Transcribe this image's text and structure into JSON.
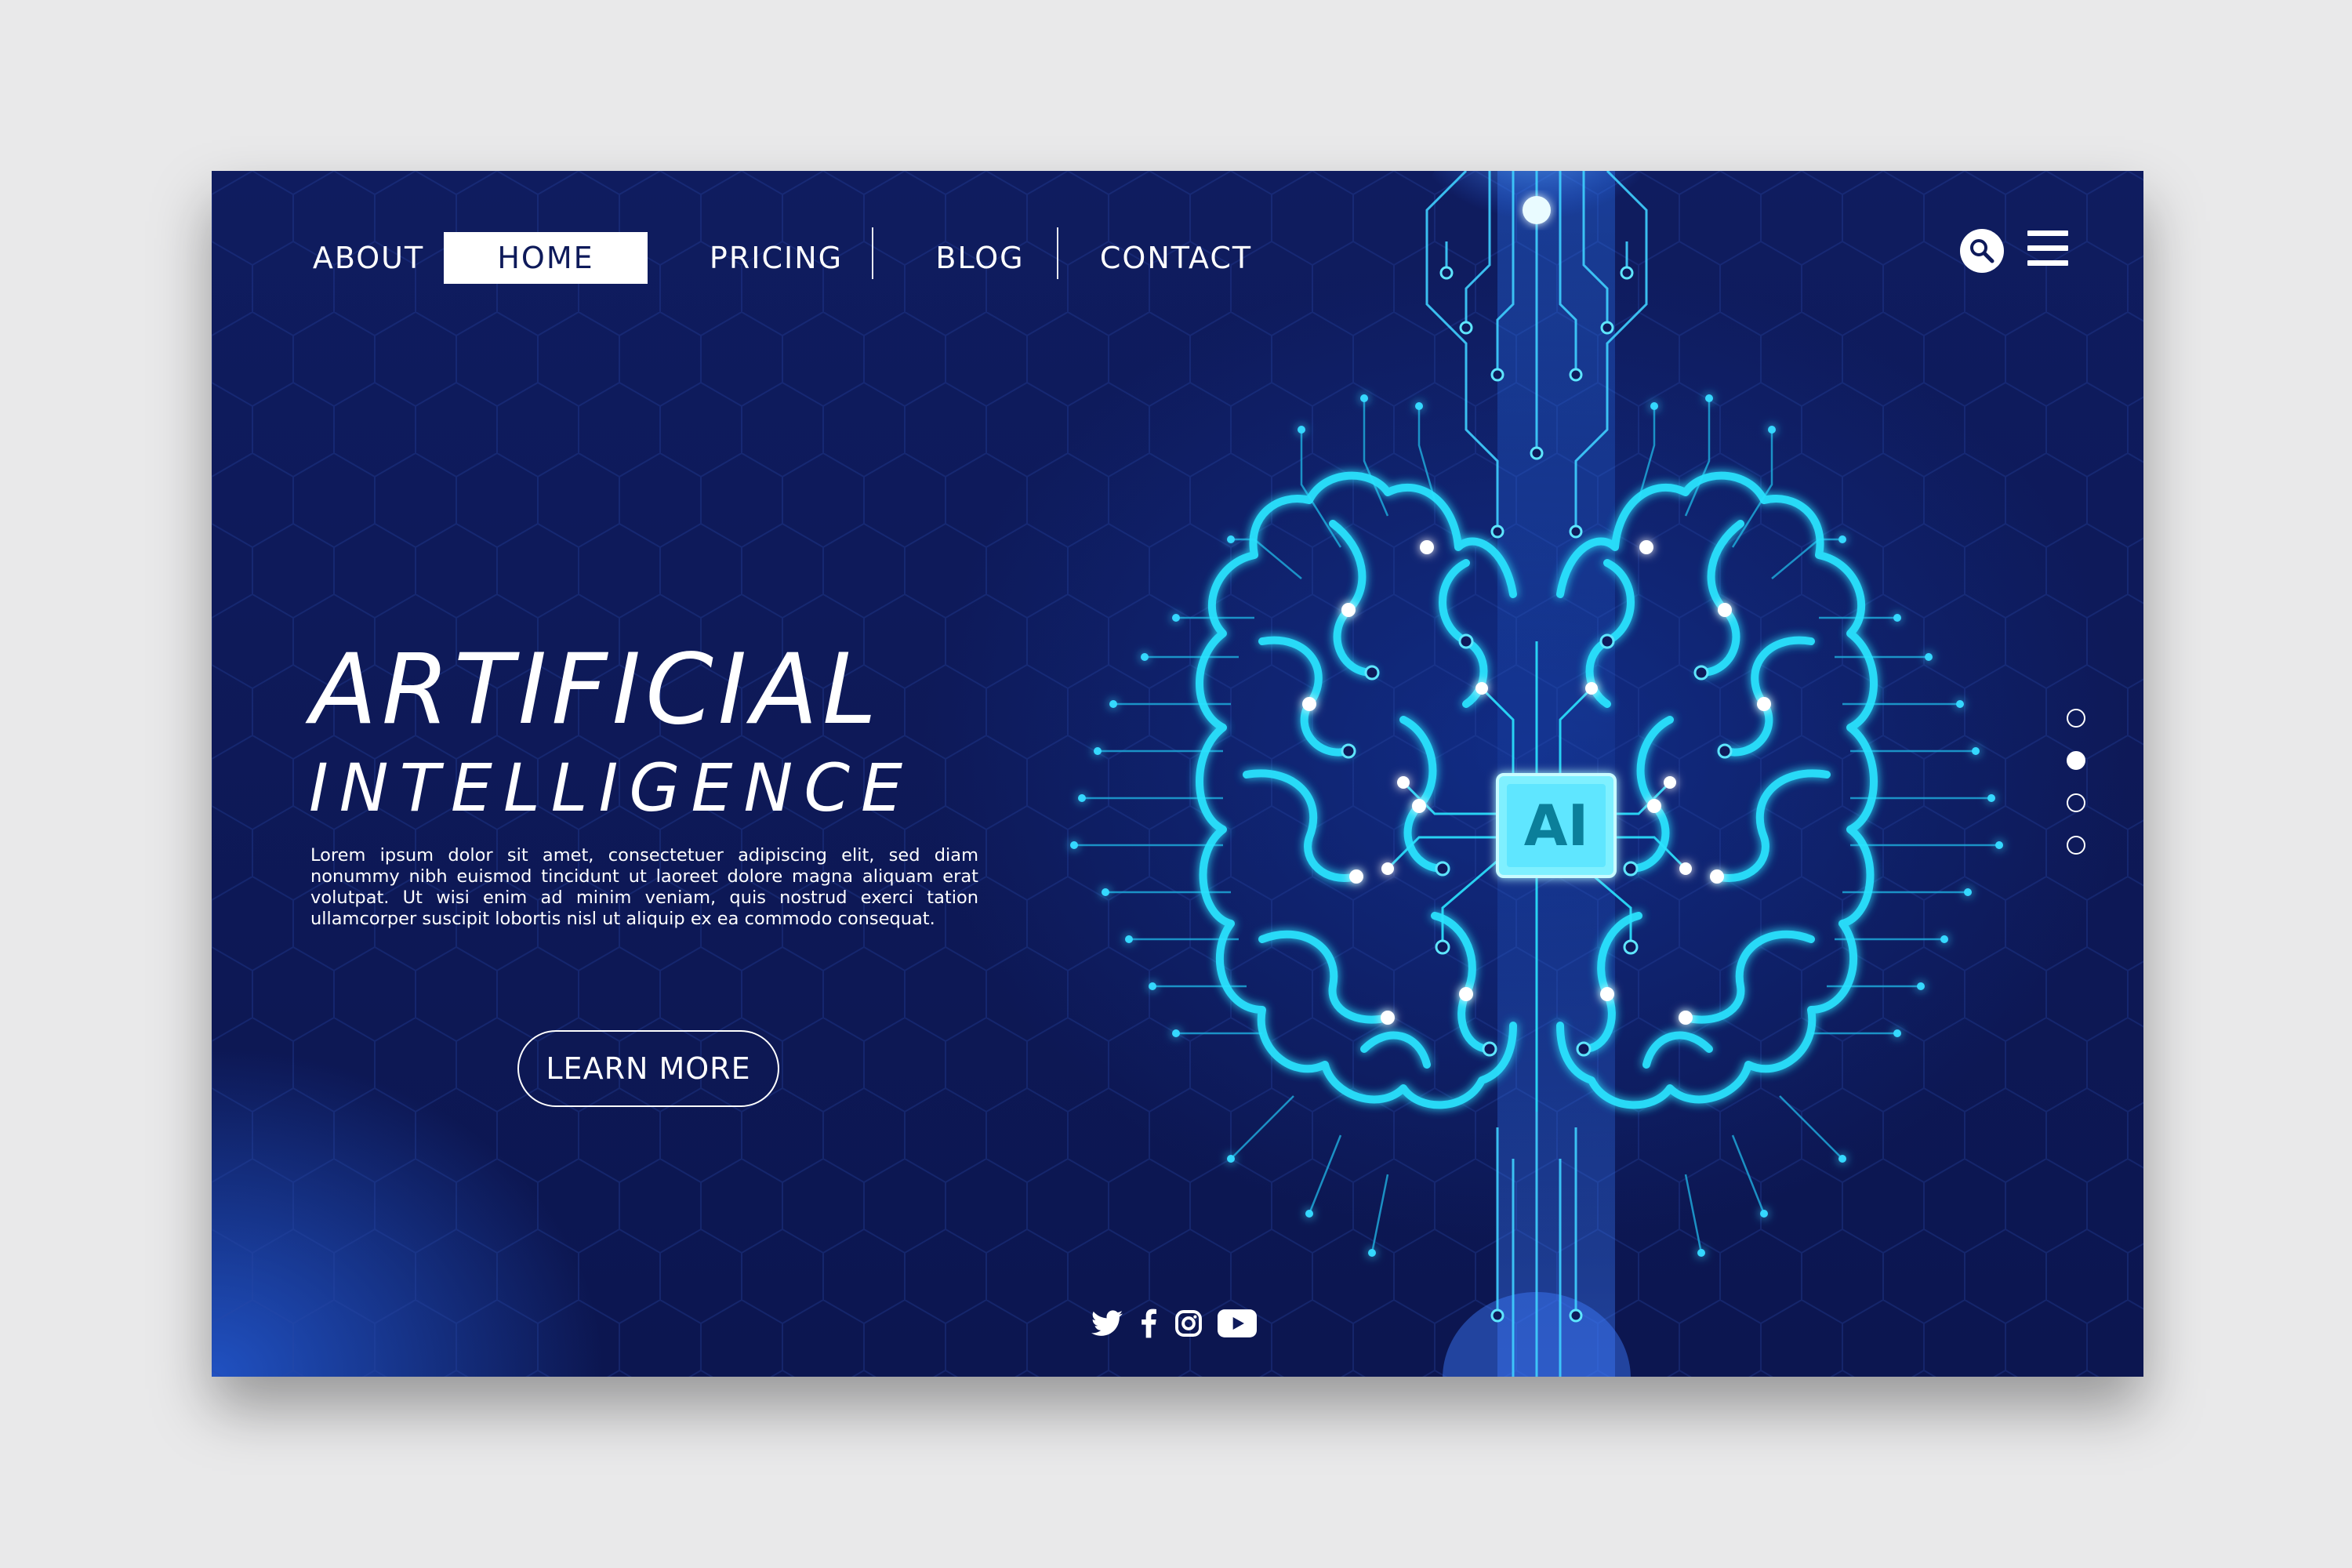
{
  "nav": {
    "items": [
      {
        "label": "ABOUT"
      },
      {
        "label": "HOME",
        "active": true
      },
      {
        "label": "PRICING"
      },
      {
        "label": "BLOG"
      },
      {
        "label": "CONTACT"
      }
    ]
  },
  "header": {
    "search_icon": "search-icon",
    "menu_icon": "hamburger-menu-icon"
  },
  "hero": {
    "title_line1": "ARTIFICIAL",
    "title_line2": "INTELLIGENCE",
    "body": "Lorem ipsum dolor sit amet, consectetuer adipiscing elit, sed diam nonummy nibh euismod tincidunt ut laoreet dolore magna aliquam erat volutpat. Ut wisi enim ad minim veniam, quis nostrud exerci tation ullamcorper suscipit lobortis nisl ut aliquip ex ea commodo consequat.",
    "cta_label": "LEARN MORE"
  },
  "illustration": {
    "chip_label": "AI",
    "description_icon": "brain-circuit-illustration"
  },
  "pagination": {
    "count": 4,
    "active_index": 1
  },
  "social": [
    {
      "icon": "twitter-icon"
    },
    {
      "icon": "facebook-icon"
    },
    {
      "icon": "instagram-icon"
    },
    {
      "icon": "youtube-icon"
    }
  ],
  "colors": {
    "background": "#0e1a5a",
    "accent": "#22e0ff",
    "page_bg": "#e9e9ea",
    "text": "#ffffff"
  }
}
